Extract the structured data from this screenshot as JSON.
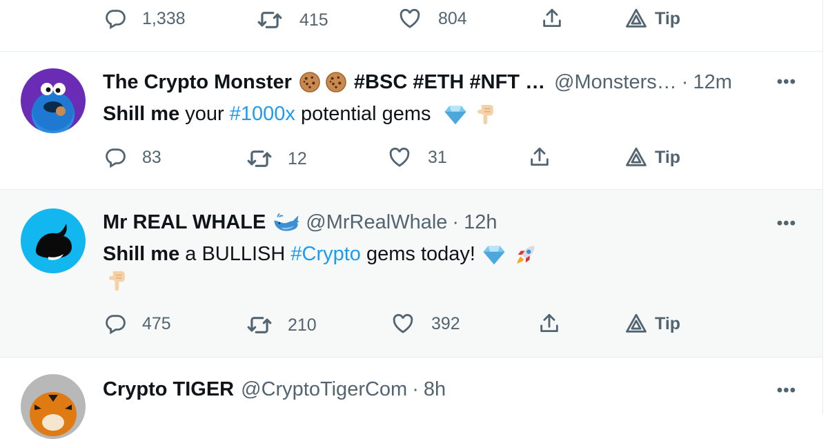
{
  "top_actions": {
    "replies": "1,338",
    "retweets": "415",
    "likes": "804",
    "tip": "Tip"
  },
  "tweets": [
    {
      "name": "The Crypto Monster",
      "name_suffix": "#BSC #ETH #NFT …",
      "handle": "@Monsters…",
      "time": "12m",
      "more": "•••",
      "text_bold": "Shill me",
      "text_1": " your ",
      "hashtag": "#1000x",
      "text_2": " potential gems",
      "replies": "83",
      "retweets": "12",
      "likes": "31",
      "tip": "Tip",
      "avatar_colors": [
        "#6a2bb5",
        "#1f7fd6"
      ]
    },
    {
      "name": "Mr REAL WHALE",
      "handle": "@MrRealWhale",
      "time": "12h",
      "more": "•••",
      "text_bold": "Shill me",
      "text_1": " a BULLISH ",
      "hashtag": "#Crypto",
      "text_2": " gems today!",
      "replies": "475",
      "retweets": "210",
      "likes": "392",
      "tip": "Tip",
      "avatar_colors": [
        "#12b7f0",
        "#0a0a0a"
      ]
    },
    {
      "name": "Crypto TIGER",
      "handle": "@CryptoTigerCom",
      "time": "8h",
      "more": "•••",
      "avatar_colors": [
        "#e07a12",
        "#b8b8b8"
      ]
    }
  ],
  "colors": {
    "accent": "#1d9bf0",
    "muted": "#536471",
    "text": "#0f1419",
    "hover_bg": "#f7f9f9"
  },
  "icons": [
    "reply-icon",
    "retweet-icon",
    "like-icon",
    "share-icon",
    "tip-icon",
    "more-icon",
    "cookie-icon",
    "diamond-icon",
    "pointing-down-icon",
    "whale-icon",
    "rocket-icon"
  ]
}
